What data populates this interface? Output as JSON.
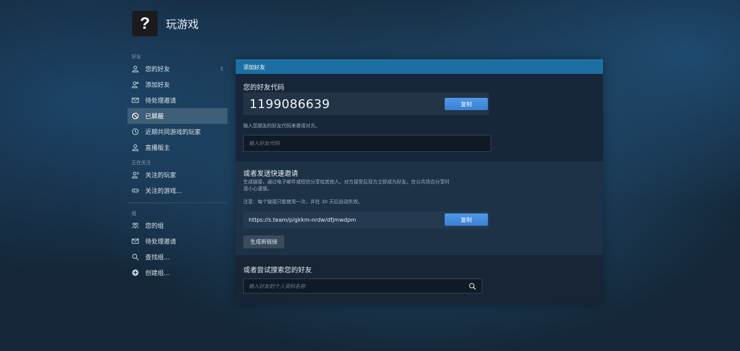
{
  "header": {
    "avatar_glyph": "?",
    "title": "玩游戏"
  },
  "sidebar": {
    "friends_section": "好友",
    "friends_items": [
      {
        "label": "您的好友",
        "icon": "person-icon",
        "count": "1"
      },
      {
        "label": "添加好友",
        "icon": "add-person-icon"
      },
      {
        "label": "待处理邀请",
        "icon": "envelope-icon"
      },
      {
        "label": "已屏蔽",
        "icon": "block-icon",
        "active": true
      },
      {
        "label": "近期共同游戏的玩家",
        "icon": "clock-icon"
      },
      {
        "label": "直播版主",
        "icon": "person-icon"
      }
    ],
    "following_section": "正在关注",
    "following_items": [
      {
        "label": "关注的玩家",
        "icon": "follow-person-icon"
      },
      {
        "label": "关注的游戏...",
        "icon": "gamepad-icon"
      }
    ],
    "groups_section": "组",
    "groups_items": [
      {
        "label": "您的组",
        "icon": "group-icon"
      },
      {
        "label": "待处理邀请",
        "icon": "envelope-icon"
      },
      {
        "label": "查找组...",
        "icon": "search-person-icon"
      },
      {
        "label": "创建组...",
        "icon": "plus-circle-icon"
      }
    ]
  },
  "panel": {
    "header": "添加好友",
    "friend_code": {
      "title": "您的好友代码",
      "code": "1199086639",
      "copy_label": "复制",
      "hint": "输入您朋友的好友代码来邀请对方。",
      "input_placeholder": "输入好友代码"
    },
    "quick_invite": {
      "title": "或者发送快速邀请",
      "desc_line1": "生成链接，通过电子邮件或短信分享给其他人。对方接受后双方立即成为好友。在公共场合分享时",
      "desc_line2": "请小心谨慎。",
      "note": "注意：每个链接只能使用一次，并在 30 天后自动失效。",
      "link": "https://s.team/p/gkkm-nrdw/dfjmwdpm",
      "copy_label": "复制",
      "generate_label": "生成新链接"
    },
    "search": {
      "title": "或者尝试搜索您的好友",
      "placeholder": "输入好友的个人资料名称"
    }
  },
  "colors": {
    "accent": "#1b6fa3",
    "button": "#4a90e2",
    "active_nav": "#3f5e78"
  }
}
